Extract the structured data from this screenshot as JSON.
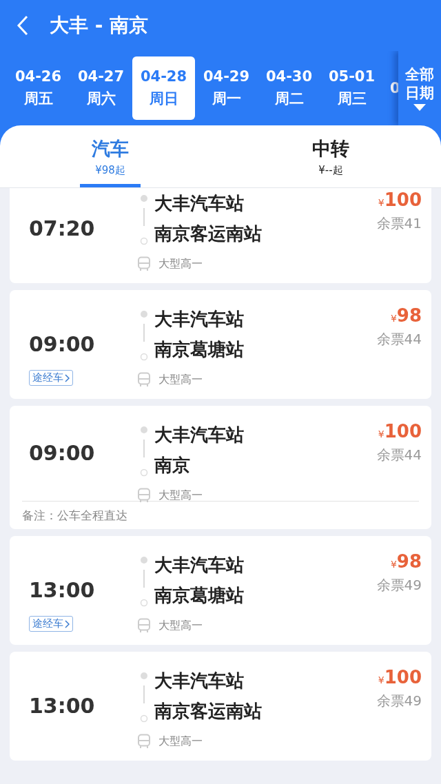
{
  "header": {
    "title": "大丰 - 南京"
  },
  "dates": [
    {
      "date": "04-26",
      "weekday": "周五",
      "selected": false
    },
    {
      "date": "04-27",
      "weekday": "周六",
      "selected": false
    },
    {
      "date": "04-28",
      "weekday": "周日",
      "selected": true
    },
    {
      "date": "04-29",
      "weekday": "周一",
      "selected": false
    },
    {
      "date": "04-30",
      "weekday": "周二",
      "selected": false
    },
    {
      "date": "05-01",
      "weekday": "周三",
      "selected": false
    },
    {
      "date": "0",
      "selected": false
    }
  ],
  "all_dates": "全部日期",
  "tabs": [
    {
      "label": "汽车",
      "price": "¥98起",
      "selected": true
    },
    {
      "label": "中转",
      "price": "¥--起",
      "selected": false
    }
  ],
  "trips": [
    {
      "time": "07:20",
      "from": "大丰汽车站",
      "to": "南京客运南站",
      "currency": "¥",
      "price": "100",
      "remaining": "余票41",
      "bus_type": "大型高一"
    },
    {
      "time": "09:00",
      "from": "大丰汽车站",
      "to": "南京葛塘站",
      "currency": "¥",
      "price": "98",
      "remaining": "余票44",
      "bus_type": "大型高一",
      "via": "途经车"
    },
    {
      "time": "09:00",
      "from": "大丰汽车站",
      "to": "南京",
      "currency": "¥",
      "price": "100",
      "remaining": "余票44",
      "bus_type": "大型高一",
      "note": "备注：公车全程直达"
    },
    {
      "time": "13:00",
      "from": "大丰汽车站",
      "to": "南京葛塘站",
      "currency": "¥",
      "price": "98",
      "remaining": "余票49",
      "bus_type": "大型高一",
      "via": "途经车"
    },
    {
      "time": "13:00",
      "from": "大丰汽车站",
      "to": "南京客运南站",
      "currency": "¥",
      "price": "100",
      "remaining": "余票49",
      "bus_type": "大型高一"
    }
  ]
}
